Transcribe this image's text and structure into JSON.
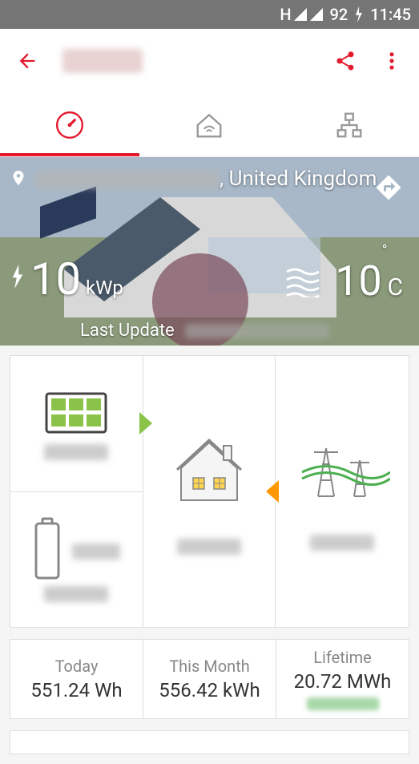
{
  "status_bar": {
    "signal_indicator": "H",
    "battery": "92",
    "battery_charging": "⚡",
    "time": "11:45"
  },
  "app_bar": {
    "title_redacted": true
  },
  "tabs": {
    "active_index": 0
  },
  "hero": {
    "location_suffix": ", United Kingdom",
    "power_value": "10",
    "power_unit": "kWp",
    "temperature": "10",
    "temp_unit": "C",
    "last_update_label": "Last Update"
  },
  "flow": {
    "solar_value_redacted": true,
    "battery_percent_redacted": true,
    "battery_value_redacted": true,
    "house_value_redacted": true,
    "grid_value_redacted": true
  },
  "stats": {
    "today": {
      "label": "Today",
      "value": "551.24  Wh"
    },
    "month": {
      "label": "This Month",
      "value": "556.42 kWh"
    },
    "lifetime": {
      "label": "Lifetime",
      "value": "20.72 MWh"
    }
  },
  "colors": {
    "accent": "#e21a2c",
    "solar_green": "#8bc34a",
    "grid_orange": "#ff9800"
  }
}
